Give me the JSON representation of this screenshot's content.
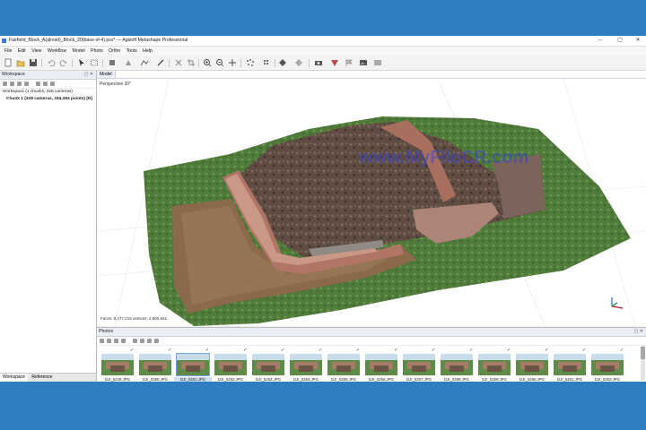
{
  "window": {
    "title": "Fairfield_Block_A(alnoid)_Block_20(base-sf-4).psx* — Agisoft Metashape Professional",
    "controls": [
      "–",
      "▢",
      "✕"
    ]
  },
  "menu": [
    "File",
    "Edit",
    "View",
    "Workflow",
    "Model",
    "Photo",
    "Ortho",
    "Tools",
    "Help"
  ],
  "workspace": {
    "header": "Workspace",
    "root": "Workspace (1 chunks, 328 cameras)",
    "chunk": "Chunk 1 (328 cameras, 184,384 points) [R]",
    "tabs": [
      "Workspace",
      "Reference"
    ]
  },
  "model": {
    "tab": "Model",
    "perspective": "Perspective 30°",
    "stats": "Faces: 9,477,216 vertices: 2,900,561",
    "watermark": "www.MyFileCR.com"
  },
  "photos": {
    "header": "Photos",
    "row1": [
      "DJI_0249.JPG",
      "DJI_0250.JPG",
      "DJI_0251.JPG",
      "DJI_0252.JPG",
      "DJI_0253.JPG",
      "DJI_0254.JPG",
      "DJI_0255.JPG",
      "DJI_0256.JPG",
      "DJI_0257.JPG",
      "DJI_0258.JPG",
      "DJI_0259.JPG",
      "DJI_0260.JPG",
      "DJI_0261.JPG",
      "DJI_0262.JPG"
    ],
    "selected_index": 2
  },
  "colors": {
    "frame": "#2f7fc0",
    "accent": "#3a7bd5",
    "watermark": "#3d46c8"
  }
}
